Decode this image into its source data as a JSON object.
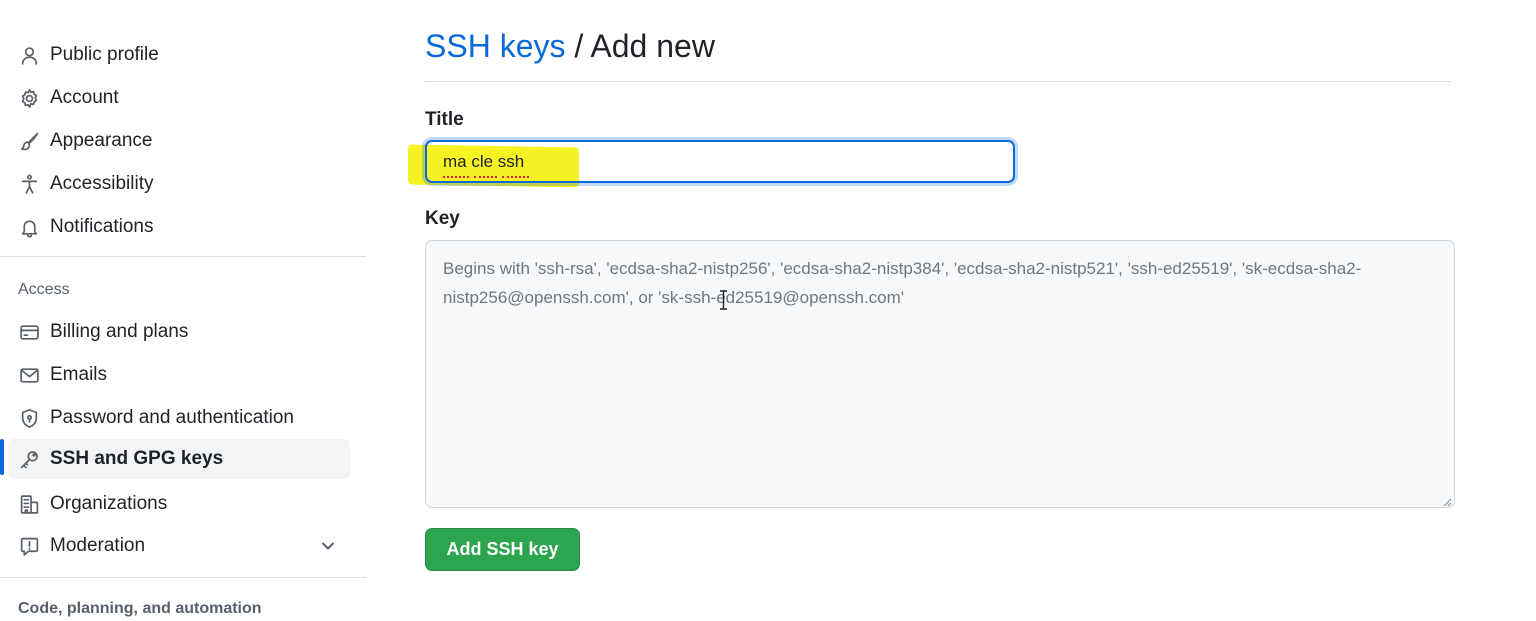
{
  "sidebar": {
    "items": [
      {
        "label": "Public profile",
        "icon": "person-icon"
      },
      {
        "label": "Account",
        "icon": "gear-icon"
      },
      {
        "label": "Appearance",
        "icon": "paintbrush-icon"
      },
      {
        "label": "Accessibility",
        "icon": "accessibility-icon"
      },
      {
        "label": "Notifications",
        "icon": "bell-icon"
      }
    ],
    "access_heading": "Access",
    "access_items": [
      {
        "label": "Billing and plans",
        "icon": "credit-card-icon"
      },
      {
        "label": "Emails",
        "icon": "mail-icon"
      },
      {
        "label": "Password and authentication",
        "icon": "shield-lock-icon"
      },
      {
        "label": "SSH and GPG keys",
        "icon": "key-icon",
        "active": true
      },
      {
        "label": "Organizations",
        "icon": "organization-icon"
      },
      {
        "label": "Moderation",
        "icon": "report-icon",
        "expandable": true
      }
    ],
    "code_heading": "Code, planning, and automation"
  },
  "main": {
    "breadcrumb_link": "SSH keys",
    "breadcrumb_separator": " / ",
    "page_title": "Add new",
    "title_label": "Title",
    "title_value": "ma cle ssh",
    "key_label": "Key",
    "key_placeholder": "Begins with 'ssh-rsa', 'ecdsa-sha2-nistp256', 'ecdsa-sha2-nistp384', 'ecdsa-sha2-nistp521', 'ssh-ed25519', 'sk-ecdsa-sha2-nistp256@openssh.com', or 'sk-ssh-ed25519@openssh.com'",
    "submit_label": "Add SSH key"
  },
  "colors": {
    "link": "#0969da",
    "primary_button": "#2da44e",
    "highlight": "#f7f118",
    "active_indicator": "#0969da"
  }
}
